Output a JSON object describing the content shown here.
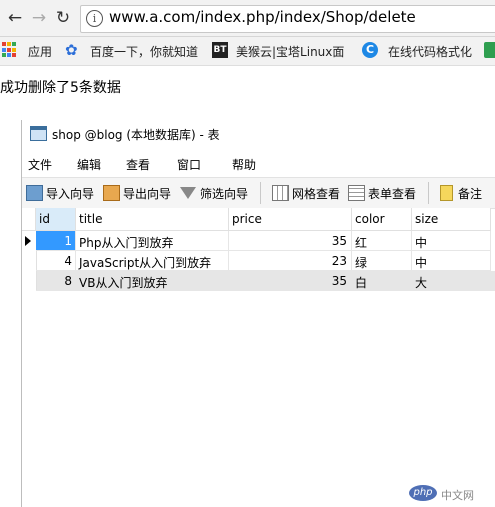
{
  "browser": {
    "back_icon": "arrow-left-icon",
    "forward_icon": "arrow-right-icon",
    "reload_icon": "reload-icon",
    "info_icon": "info-icon",
    "url": "www.a.com/index.php/index/Shop/delete"
  },
  "bookmarks": [
    {
      "label": "应用",
      "icon": "apps-grid-icon"
    },
    {
      "label": "百度一下，你就知道",
      "icon": "baidu-paw-icon"
    },
    {
      "label": "美猴云|宝塔Linux面",
      "icon_text": "BT"
    },
    {
      "label": "在线代码格式化",
      "icon": "c-logo-icon"
    }
  ],
  "page": {
    "message": "成功删除了5条数据"
  },
  "navicat": {
    "title": "shop @blog (本地数据库) - 表",
    "menu": [
      "文件",
      "编辑",
      "查看",
      "窗口",
      "帮助"
    ],
    "toolbar": [
      "导入向导",
      "导出向导",
      "筛选向导",
      "网格查看",
      "表单查看",
      "备注"
    ],
    "columns": [
      "id",
      "title",
      "price",
      "color",
      "size"
    ],
    "rows": [
      {
        "id": "1",
        "title": "Php从入门到放弃",
        "price": "35",
        "color": "红",
        "size": "中"
      },
      {
        "id": "4",
        "title": "JavaScript从入门到放弃",
        "price": "23",
        "color": "绿",
        "size": "中"
      },
      {
        "id": "8",
        "title": "VB从入门到放弃",
        "price": "35",
        "color": "白",
        "size": "大"
      }
    ]
  },
  "watermark": {
    "logo": "php",
    "text": "中文网"
  },
  "colors": {
    "selected_cell": "#3399ff",
    "row_highlight": "#e6e6e6",
    "header_id_bg": "#d9ebf9"
  }
}
